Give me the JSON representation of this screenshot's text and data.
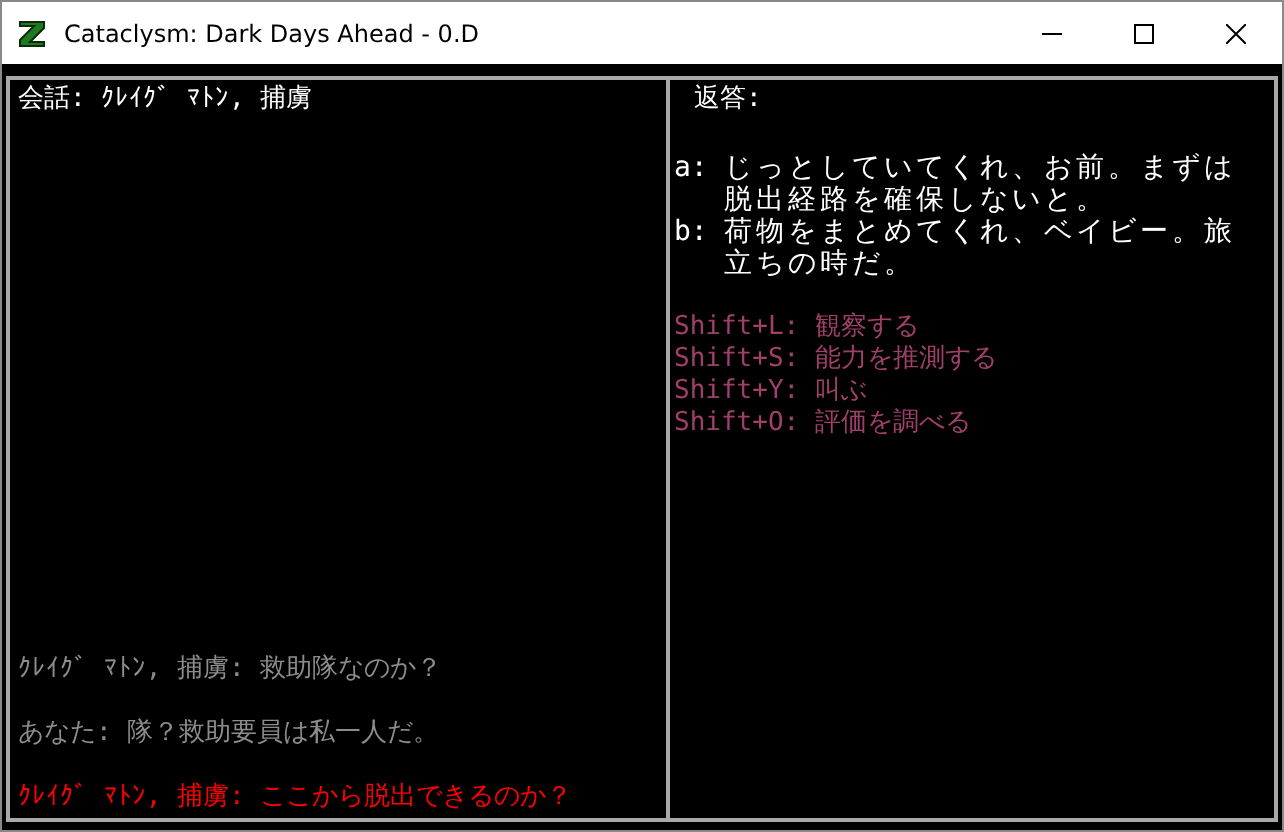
{
  "window": {
    "title": "Cataclysm: Dark Days Ahead - 0.D"
  },
  "conversation": {
    "heading": "会話: ｸﾚｲｸﾞ ﾏﾄﾝ, 捕虜",
    "log": [
      {
        "text": "ｸﾚｲｸﾞ ﾏﾄﾝ, 捕虜: 救助隊なのか？",
        "color": "#8c8c8c"
      },
      {
        "text": "あなた: 隊？救助要員は私一人だ。",
        "color": "#8c8c8c"
      },
      {
        "text": "ｸﾚｲｸﾞ ﾏﾄﾝ, 捕虜: ここから脱出できるのか？",
        "color": "#ff0000"
      }
    ]
  },
  "responses": {
    "heading": "返答:",
    "items": [
      {
        "key": "a:",
        "text": "じっとしていてくれ、お前。まずは脱出経路を確保しないと。"
      },
      {
        "key": "b:",
        "text": "荷物をまとめてくれ、ベイビー。旅立ちの時だ。"
      }
    ],
    "actions": [
      {
        "key": "Shift+L:",
        "text": "観察する"
      },
      {
        "key": "Shift+S:",
        "text": "能力を推測する"
      },
      {
        "key": "Shift+Y:",
        "text": "叫ぶ"
      },
      {
        "key": "Shift+O:",
        "text": "評価を調べる"
      }
    ]
  }
}
